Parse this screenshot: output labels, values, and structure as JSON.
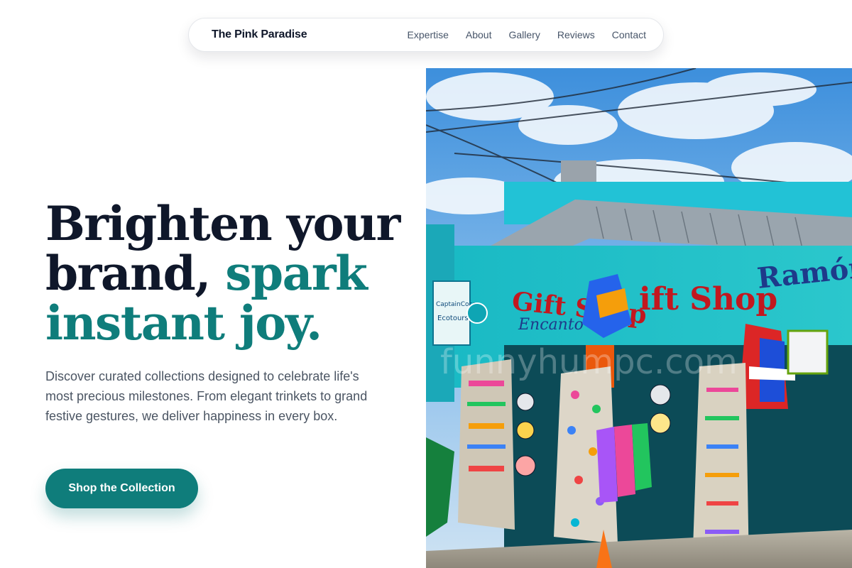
{
  "nav": {
    "brand": "The Pink Paradise",
    "links": [
      "Expertise",
      "About",
      "Gallery",
      "Reviews",
      "Contact"
    ]
  },
  "hero": {
    "title_line1": "Brighten your",
    "title_line2_plain": "brand, ",
    "title_line2_accent": "spark",
    "title_line3_accent": "instant joy.",
    "description": "Discover curated collections designed to celebrate life's most precious milestones. From elegant trinkets to grand festive gestures, we deliver happiness in every box.",
    "cta_label": "Shop the Collection"
  },
  "image": {
    "sign_left": "Gift Shop",
    "sign_center": "ift Shop",
    "sign_right": "Ramón",
    "sign_small": "Encanto",
    "sign_tours_1": "CaptainCoco",
    "sign_tours_2": "Ecotours",
    "watermark": "funnyhumpc.com"
  },
  "colors": {
    "accent": "#0f7d7b",
    "heading": "#0f172a",
    "body_text": "#4b5563"
  }
}
